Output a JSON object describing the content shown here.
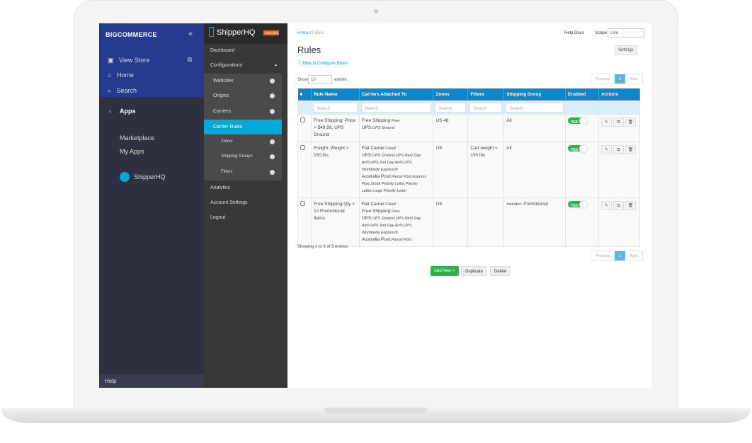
{
  "bigcommerce": {
    "logo": "BIGCOMMERCE",
    "collapse": "«",
    "items": [
      {
        "label": "View Store",
        "icon": "store-icon"
      },
      {
        "label": "Home",
        "icon": "home-icon"
      },
      {
        "label": "Search",
        "icon": "search-icon"
      }
    ],
    "apps": "Apps",
    "links": [
      "Marketplace",
      "My Apps"
    ],
    "app": "ShipperHQ",
    "help": "Help"
  },
  "shipperhq": {
    "logo": "ShipperHQ",
    "badge": "Free trial",
    "nav": [
      {
        "label": "Dashboard"
      },
      {
        "label": "Configurations"
      }
    ],
    "sub": [
      "Websites",
      "Origins",
      "Carriers"
    ],
    "active": "Carrier Rules",
    "subsub": [
      "Zones",
      "Shipping Groups",
      "Filters"
    ],
    "bottom": [
      "Analytics",
      "Account Settings",
      "Logout"
    ]
  },
  "main": {
    "breadcrumb": {
      "home": "Home",
      "sep": "/",
      "current": "Filters"
    },
    "help_docs": "Help Docs",
    "scope_label": "Scope",
    "scope_value": "Live",
    "title": "Rules",
    "settings": "Settings",
    "howto": "How to Configure Rules",
    "show": "Show",
    "entries_value": "10",
    "entries": "entries",
    "prev": "Previous",
    "page": "1",
    "next": "Next",
    "showing": "Showing 1 to 3 of 3 entries",
    "add": "Add New +",
    "duplicate": "Duplicate",
    "delete": "Delete"
  },
  "table": {
    "headers": [
      "Rule Name",
      "Carriers Attached To",
      "Zones",
      "Filters",
      "Shipping Group",
      "Enabled",
      "Actions"
    ],
    "search_placeholder": "Search",
    "enabled_label": "YES",
    "rows": [
      {
        "name": "Free Shipping: Price > $49.99, UPS Ground",
        "carriers": [
          [
            "Free Shipping:",
            "Free"
          ],
          [
            "UPS:",
            "UPS Ground"
          ]
        ],
        "zones": "US 48",
        "filters": "",
        "group_prefix": "",
        "group": "All"
      },
      {
        "name": "Freight: Weight > 150 lbs",
        "carriers": [
          [
            "Flat Carrier:",
            "Fixed"
          ],
          [
            "UPS:",
            "UPS Ground,UPS Next Day Air®,UPS 2nd Day Air®,UPS Worldwide Express®"
          ],
          [
            "Australia Post:",
            "Parcel Post,Express Post,Small Priority Letter,Priority Letter,Large Priority Letter"
          ]
        ],
        "zones": "US",
        "filters": "Cart weight < 150 lbs",
        "group_prefix": "",
        "group": "All"
      },
      {
        "name": "Free Shipping Qty > 10 Promotional Items",
        "carriers": [
          [
            "Flat Carrier:",
            "Fixed"
          ],
          [
            "Free Shipping:",
            "Free"
          ],
          [
            "UPS:",
            "UPS Ground,UPS Next Day Air®,UPS 2nd Day Air®,UPS Worldwide Express®"
          ],
          [
            "Australia Post:",
            "Parcel Post"
          ]
        ],
        "zones": "US",
        "filters": "",
        "group_prefix": "Includes:",
        "group": "Promotional"
      }
    ]
  },
  "colors": {
    "bc_blue": "#273b8e",
    "bc_dark": "#2f3040",
    "accent": "#00a9d6",
    "header": "#0e86c7",
    "green": "#2cb24a",
    "badge": "#f26b1d"
  }
}
